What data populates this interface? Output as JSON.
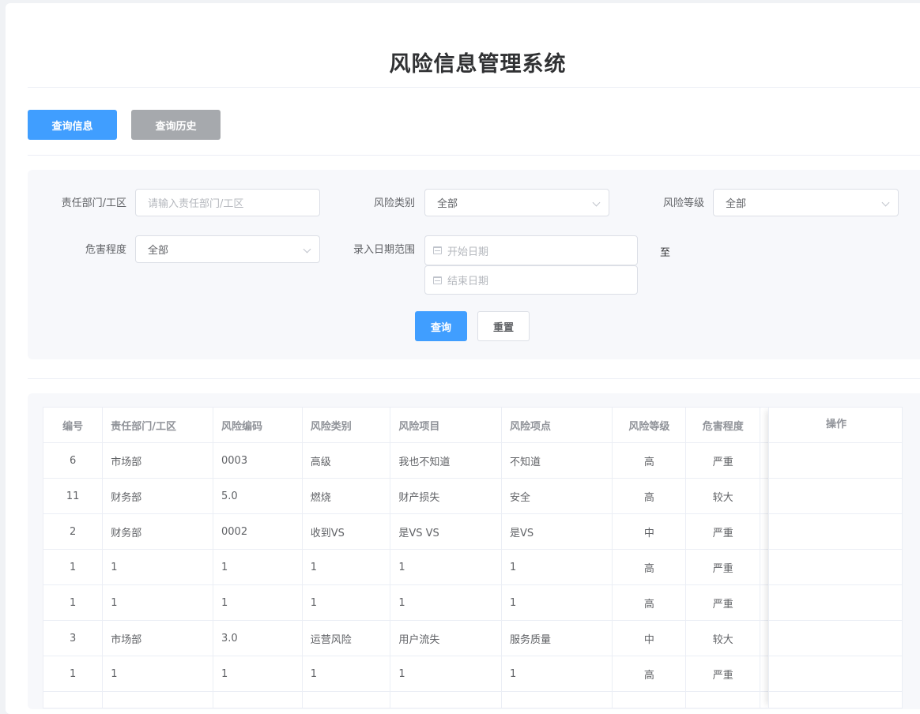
{
  "header": {
    "title": "风险信息管理系统"
  },
  "tabs": [
    {
      "label": "查询信息",
      "active": true
    },
    {
      "label": "查询历史",
      "active": false
    }
  ],
  "filters": {
    "dept_label": "责任部门/工区",
    "dept_placeholder": "请输入责任部门/工区",
    "category_label": "风险类别",
    "category_value": "全部",
    "level_label": "风险等级",
    "level_value": "全部",
    "harm_label": "危害程度",
    "harm_value": "全部",
    "date_label": "录入日期范围",
    "start_placeholder": "开始日期",
    "end_placeholder": "结束日期",
    "to_text": "至",
    "search_label": "查询",
    "reset_label": "重置"
  },
  "table": {
    "columns": [
      "编号",
      "责任部门/工区",
      "风险编码",
      "风险类别",
      "风险项目",
      "风险项点",
      "风险等级",
      "危害程度"
    ],
    "ops_label": "操作",
    "rows": [
      [
        "6",
        "市场部",
        "0003",
        "高级",
        "我也不知道",
        "不知道",
        "高",
        "严重"
      ],
      [
        "11",
        "财务部",
        "5.0",
        "燃烧",
        "财产损失",
        "安全",
        "高",
        "较大"
      ],
      [
        "2",
        "财务部",
        "0002",
        "收到VS",
        "是VS VS",
        "是VS",
        "中",
        "严重"
      ],
      [
        "1",
        "1",
        "1",
        "1",
        "1",
        "1",
        "高",
        "严重"
      ],
      [
        "1",
        "1",
        "1",
        "1",
        "1",
        "1",
        "高",
        "严重"
      ],
      [
        "3",
        "市场部",
        "3.0",
        "运营风险",
        "用户流失",
        "服务质量",
        "中",
        "较大"
      ],
      [
        "1",
        "1",
        "1",
        "1",
        "1",
        "1",
        "高",
        "严重"
      ],
      [
        "",
        "",
        "",
        "",
        "",
        "",
        "",
        ""
      ]
    ]
  },
  "colors": {
    "primary": "#409eff",
    "inactive_tab": "#a6a9ad",
    "panel_bg": "#f7f8fb"
  },
  "icons": {
    "select_arrow": "chevron-down-icon",
    "date_picker": "calendar-icon"
  }
}
